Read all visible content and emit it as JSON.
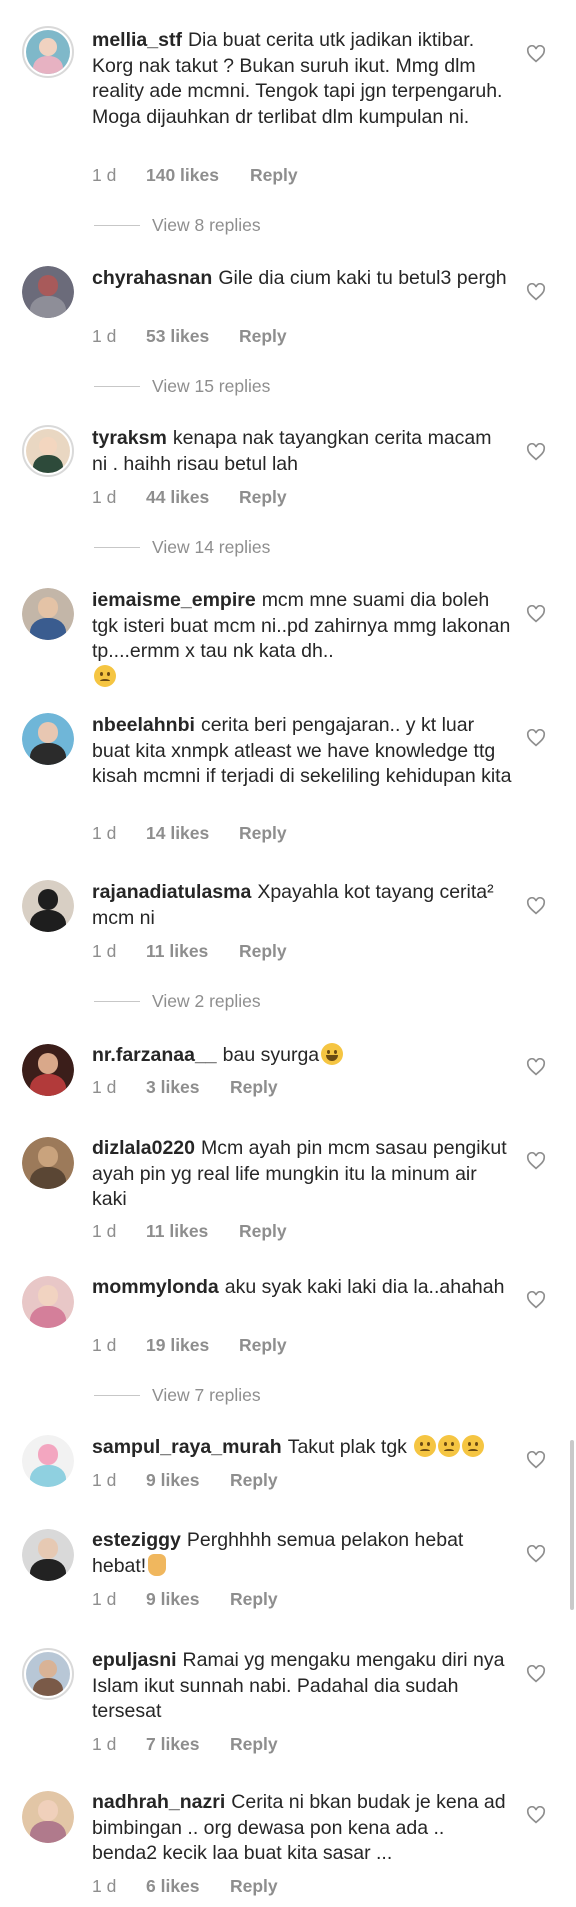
{
  "comments": [
    {
      "username": "mellia_stf",
      "text": "Dia buat cerita utk jadikan iktibar. Korg nak takut ? Bukan suruh ikut. Mmg dlm reality ade mcmni. Tengok tapi jgn terpengaruh. Moga dijauhkan dr terlibat dlm kumpulan ni.",
      "time": "1 d",
      "likes": "140 likes",
      "reply": "Reply",
      "view_replies": "View 8 replies",
      "avatar_colors": [
        "#7fb8c9",
        "#e7b2c2"
      ]
    },
    {
      "username": "chyrahasnan",
      "text": "Gile dia cium kaki tu betul3 pergh",
      "time": "1 d",
      "likes": "53 likes",
      "reply": "Reply",
      "view_replies": "View 15 replies",
      "avatar_colors": [
        "#a85a5a",
        "#6b6b7a"
      ]
    },
    {
      "username": "tyraksm",
      "text": "kenapa nak tayangkan cerita macam ni . haihh risau betul lah",
      "time": "1 d",
      "likes": "44 likes",
      "reply": "Reply",
      "view_replies": "View 14 replies",
      "avatar_colors": [
        "#e9d7c2",
        "#2d4a3a"
      ]
    },
    {
      "username": "iemaisme_empire",
      "text": "mcm mne suami dia boleh tgk isteri buat mcm ni..pd zahirnya mmg lakonan tp....ermm x tau nk kata dh..",
      "emoji": "sad",
      "avatar_colors": [
        "#c3b6a8",
        "#3a5c8f"
      ]
    },
    {
      "username": "nbeelahnbi",
      "text": "cerita beri pengajaran.. y kt luar buat kita xnmpk atleast we have knowledge ttg kisah mcmni if terjadi di sekeliling kehidupan kita",
      "time": "1 d",
      "likes": "14 likes",
      "reply": "Reply",
      "avatar_colors": [
        "#6fb6d8",
        "#2b2b2b"
      ]
    },
    {
      "username": "rajanadiatulasma",
      "text": "Xpayahla kot tayang cerita² mcm ni",
      "time": "1 d",
      "likes": "11 likes",
      "reply": "Reply",
      "view_replies": "View 2 replies",
      "avatar_colors": [
        "#d8cfc4",
        "#1e1e1e"
      ]
    },
    {
      "username": "nr.farzanaa__",
      "text": "bau syurga",
      "emoji": "laugh",
      "time": "1 d",
      "likes": "3 likes",
      "reply": "Reply",
      "avatar_colors": [
        "#3b1e1a",
        "#b23a3a"
      ]
    },
    {
      "username": "dizlala0220",
      "text": "Mcm ayah pin mcm sasau pengikut ayah pin yg real life mungkin itu la minum air kaki",
      "time": "1 d",
      "likes": "11 likes",
      "reply": "Reply",
      "avatar_colors": [
        "#9c7a5a",
        "#5a4634"
      ]
    },
    {
      "username": "mommylonda",
      "text": "aku syak kaki laki dia la..ahahah",
      "time": "1 d",
      "likes": "19 likes",
      "reply": "Reply",
      "view_replies": "View 7 replies",
      "avatar_colors": [
        "#e8c7c7",
        "#d47f9a"
      ]
    },
    {
      "username": "sampul_raya_murah",
      "text": "Takut plak tgk",
      "emoji": "sad3",
      "time": "1 d",
      "likes": "9 likes",
      "reply": "Reply",
      "avatar_colors": [
        "#f2f2f2",
        "#8fd0e0"
      ]
    },
    {
      "username": "esteziggy",
      "text": "Perghhhh semua pelakon hebat hebat!",
      "emoji": "thumb",
      "time": "1 d",
      "likes": "9 likes",
      "reply": "Reply",
      "avatar_colors": [
        "#d9d9d9",
        "#222222"
      ]
    },
    {
      "username": "epuljasni",
      "text": "Ramai yg mengaku mengaku diri nya Islam ikut sunnah nabi. Padahal dia sudah tersesat",
      "time": "1 d",
      "likes": "7 likes",
      "reply": "Reply",
      "avatar_colors": [
        "#b8c7d6",
        "#7a5a48"
      ]
    },
    {
      "username": "nadhrah_nazri",
      "text": "Cerita ni bkan budak je kena ad bimbingan .. org dewasa pon kena ada .. benda2 kecik laa buat kita sasar ...",
      "time": "1 d",
      "likes": "6 likes",
      "reply": "Reply",
      "avatar_colors": [
        "#e2c6a6",
        "#b07a8c"
      ]
    }
  ]
}
